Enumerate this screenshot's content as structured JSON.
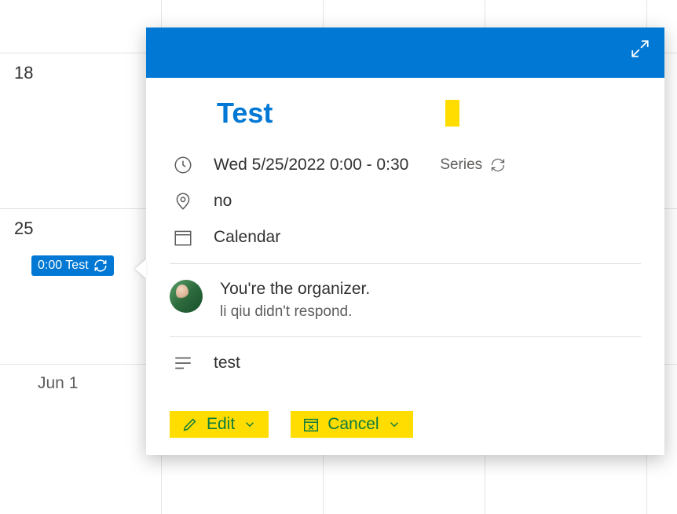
{
  "calendar": {
    "day18": "18",
    "day25": "25",
    "jun1": "Jun 1",
    "event_chip": "0:00 Test"
  },
  "card": {
    "title": "Test",
    "datetime": "Wed 5/25/2022 0:00 - 0:30",
    "series_label": "Series",
    "location": "no",
    "calendar_name": "Calendar",
    "organizer_line": "You're the organizer.",
    "response_line": "li qiu didn't respond.",
    "note": "test",
    "edit_label": "Edit",
    "cancel_label": "Cancel"
  }
}
